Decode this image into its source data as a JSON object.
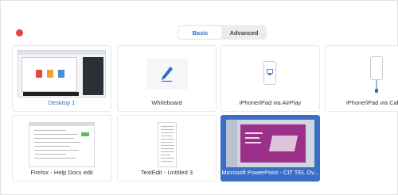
{
  "tabs": [
    {
      "label": "Basic",
      "active": true
    },
    {
      "label": "Advanced",
      "active": false
    }
  ],
  "sources": [
    {
      "label": "Desktop 1",
      "thumb": "desktop-screenshot",
      "state": "current"
    },
    {
      "label": "Whiteboard",
      "thumb": "pen-icon",
      "state": "normal"
    },
    {
      "label": "iPhone/iPad via AirPlay",
      "thumb": "airplay-phone-icon",
      "state": "normal"
    },
    {
      "label": "iPhone/iPad via Cable",
      "thumb": "cable-phone-icon",
      "state": "normal"
    },
    {
      "label": "Firefox - Help Docs edit",
      "thumb": "browser-window",
      "state": "normal"
    },
    {
      "label": "TextEdit - Untitled 3",
      "thumb": "text-document",
      "state": "normal"
    },
    {
      "label": "Microsoft PowerPoint - CIT TEL Ov...",
      "thumb": "presentation-slide",
      "state": "selected"
    }
  ],
  "colors": {
    "accent": "#2d6fbe",
    "selected": "#3a6ec6",
    "close": "#e8453c"
  }
}
